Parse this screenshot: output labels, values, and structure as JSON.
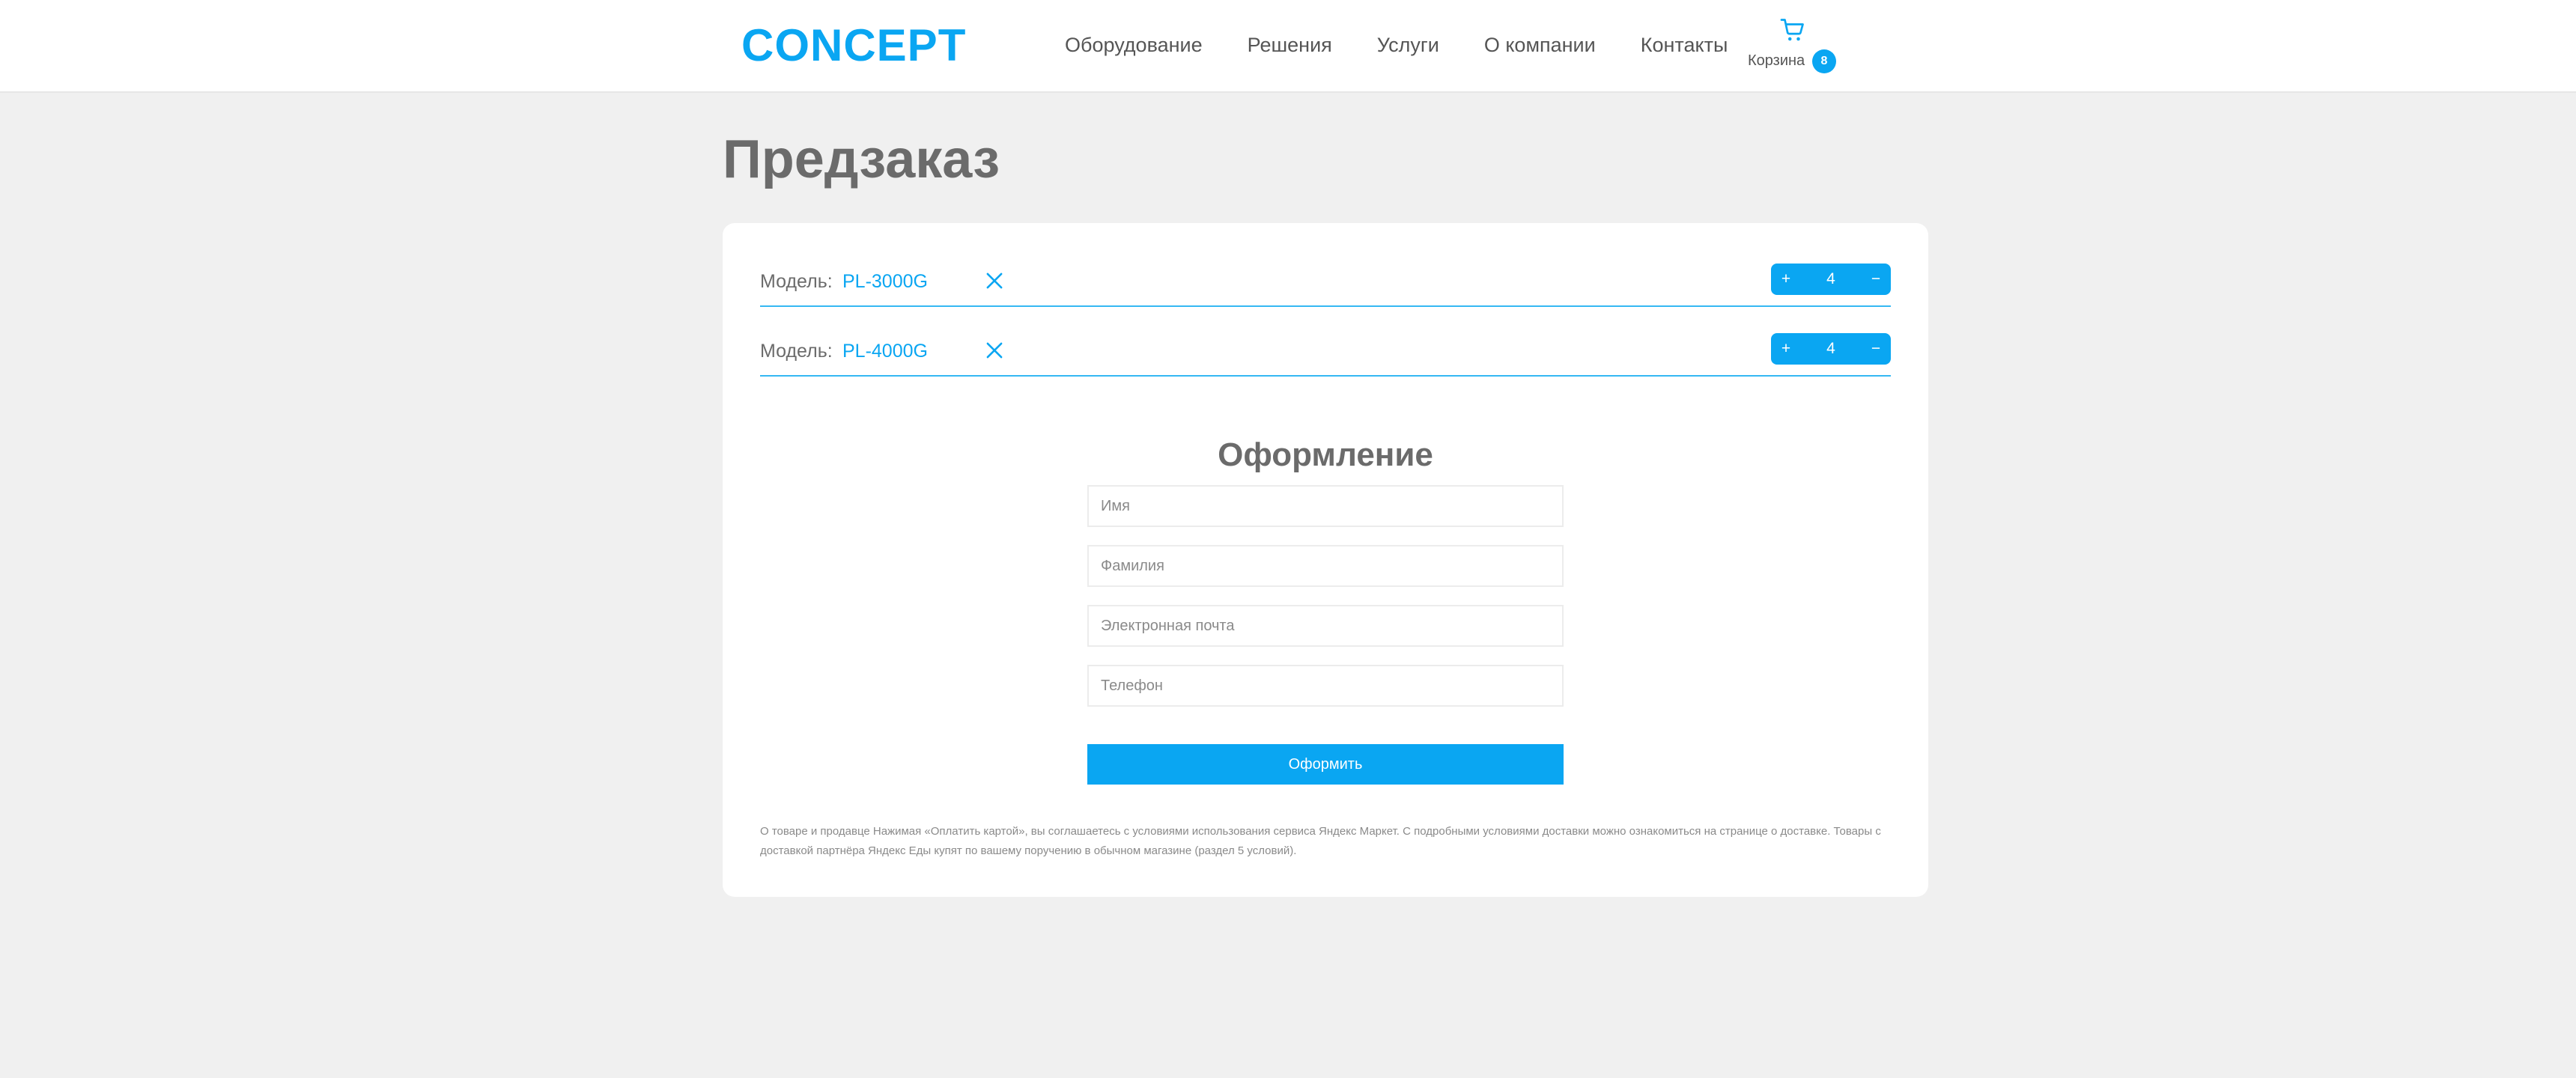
{
  "header": {
    "logo": "CONCEPT",
    "nav": [
      "Оборудование",
      "Решения",
      "Услуги",
      "О компании",
      "Контакты"
    ],
    "cart": {
      "label": "Корзина",
      "count": "8"
    }
  },
  "page": {
    "title": "Предзаказ"
  },
  "order": {
    "items": [
      {
        "label": "Модель:",
        "model": "PL-3000G",
        "quantity": "4",
        "plus": "+",
        "minus": "−"
      },
      {
        "label": "Модель:",
        "model": "PL-4000G",
        "quantity": "4",
        "plus": "+",
        "minus": "−"
      }
    ]
  },
  "form": {
    "title": "Оформление",
    "fields": {
      "first_name": {
        "placeholder": "Имя",
        "value": ""
      },
      "last_name": {
        "placeholder": "Фамилия",
        "value": ""
      },
      "email": {
        "placeholder": "Электронная почта",
        "value": ""
      },
      "phone": {
        "placeholder": "Телефон",
        "value": ""
      }
    },
    "submit_label": "Оформить"
  },
  "disclaimer": "О товаре и продавце Нажимая «Оплатить картой», вы соглашаетесь с условиями использования сервиса Яндекс Маркет. С подробными условиями доставки можно ознакомиться на странице о доставке. Товары с доставкой партнёра Яндекс Еды купят по вашему поручению в обычном магазине (раздел 5 условий).",
  "colors": {
    "accent": "#0aa6f2",
    "background": "#f0f0f0",
    "card": "#ffffff",
    "text": "#6b6b6b"
  },
  "icons": {
    "cart": "shopping-cart-icon",
    "remove": "close-icon"
  }
}
